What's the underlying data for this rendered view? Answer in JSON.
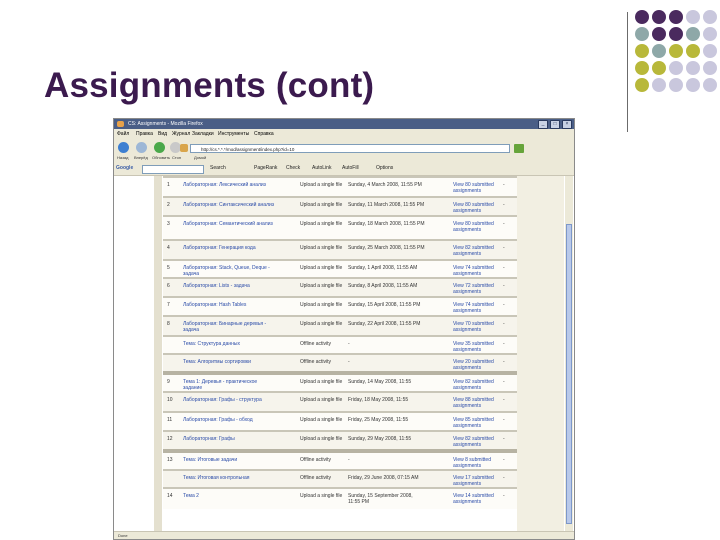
{
  "slide": {
    "title": "Assignments (cont)"
  },
  "colors": {
    "title": "#3b1a4e",
    "purple": "#4a2a5e",
    "teal": "#8ea8a8",
    "olive": "#b8b83a",
    "lavender": "#c9c7dd"
  },
  "browser": {
    "title": "CS: Assignments - Mozilla Firefox",
    "menu": [
      "Файл",
      "Правка",
      "Вид",
      "Журнал",
      "Закладки",
      "Инструменты",
      "Справка"
    ],
    "nav_labels": [
      "Назад",
      "Вперёд",
      "Обновить",
      "Стоп",
      "Домой"
    ],
    "address": "http://cs.*.*.*/mod/assignment/index.php?id=10",
    "google_label": "Google",
    "google_items": [
      "Search",
      "PageRank",
      "Check",
      "AutoLink",
      "AutoFill",
      "Options"
    ]
  },
  "rows": [
    {
      "num": "1",
      "name": "Лабораторная: Лексический анализ",
      "type": "Upload a single file",
      "due": "Sunday, 4 March 2008, 11:55 PM",
      "submitted": "View 80 submitted assignments",
      "extra": "-"
    },
    {
      "num": "2",
      "name": "Лабораторная: Синтаксический анализ",
      "type": "Upload a single file",
      "due": "Sunday, 11 March 2008, 11:55 PM",
      "submitted": "View 80 submitted assignments",
      "extra": "-"
    },
    {
      "num": "3",
      "name": "Лабораторная: Семантический анализ",
      "type": "Upload a single file",
      "due": "Sunday, 18 March 2008, 11:55 PM",
      "submitted": "View 80 submitted assignments",
      "extra": "-"
    },
    {
      "num": "4",
      "name": "Лабораторная: Генерация кода",
      "type": "Upload a single file",
      "due": "Sunday, 25 March 2008, 11:55 PM",
      "submitted": "View 82 submitted assignments",
      "extra": "-"
    },
    {
      "num": "5",
      "name": "Лабораторная: Stack, Queue, Deque - задача",
      "type": "Upload a single file",
      "due": "Sunday, 1 April 2008, 11:55 AM",
      "submitted": "View 74 submitted assignments",
      "extra": "-"
    },
    {
      "num": "6",
      "name": "Лабораторная: Lists - задача",
      "type": "Upload a single file",
      "due": "Sunday, 8 April 2008, 11:55 AM",
      "submitted": "View 72 submitted assignments",
      "extra": "-"
    },
    {
      "num": "7",
      "name": "Лабораторная: Hash Tables",
      "type": "Upload a single file",
      "due": "Sunday, 15 April 2008, 11:55 PM",
      "submitted": "View 74 submitted assignments",
      "extra": "-"
    },
    {
      "num": "8",
      "name": "Лабораторная: Бинарные деревья - задача",
      "type": "Upload a single file",
      "due": "Sunday, 22 April 2008, 11:55 PM",
      "submitted": "View 70 submitted assignments",
      "extra": "-"
    },
    {
      "num": "",
      "name": "Тема: Структура данных",
      "type": "Offline activity",
      "due": "-",
      "submitted": "View 35 submitted assignments",
      "extra": "-"
    },
    {
      "num": "",
      "name": "Тема: Алгоритмы сортировки",
      "type": "Offline activity",
      "due": "-",
      "submitted": "View 20 submitted assignments",
      "extra": "-"
    },
    {
      "num": "9",
      "name": "Тема 1: Деревья - практическое задание",
      "type": "Upload a single file",
      "due": "Sunday, 14 May 2008, 11:55",
      "submitted": "View 82 submitted assignments",
      "extra": "-"
    },
    {
      "num": "10",
      "name": "Лабораторная: Графы - структура",
      "type": "Upload a single file",
      "due": "Friday, 18 May 2008, 11:55",
      "submitted": "View 88 submitted assignments",
      "extra": "-"
    },
    {
      "num": "11",
      "name": "Лабораторная: Графы - обход",
      "type": "Upload a single file",
      "due": "Friday, 25 May 2008, 11:55",
      "submitted": "View 85 submitted assignments",
      "extra": "-"
    },
    {
      "num": "12",
      "name": "Лабораторная: Графы",
      "type": "Upload a single file",
      "due": "Sunday, 29 May 2008, 11:55",
      "submitted": "View 82 submitted assignments",
      "extra": "-"
    },
    {
      "num": "13",
      "name": "Тема: Итоговые задачи",
      "type": "Offline activity",
      "due": "-",
      "submitted": "View 8 submitted assignments",
      "extra": "-"
    },
    {
      "num": "",
      "name": "Тема: Итоговая контрольная",
      "type": "Offline activity",
      "due": "Friday, 29 June 2008, 07:15 AM",
      "submitted": "View 17 submitted assignments",
      "extra": "-"
    },
    {
      "num": "14",
      "name": "Тема 2",
      "type": "Upload a single file",
      "due": "Sunday, 15 September 2008, 11:55 PM",
      "submitted": "View 14 submitted assignments",
      "extra": "-"
    }
  ],
  "status": "Done"
}
